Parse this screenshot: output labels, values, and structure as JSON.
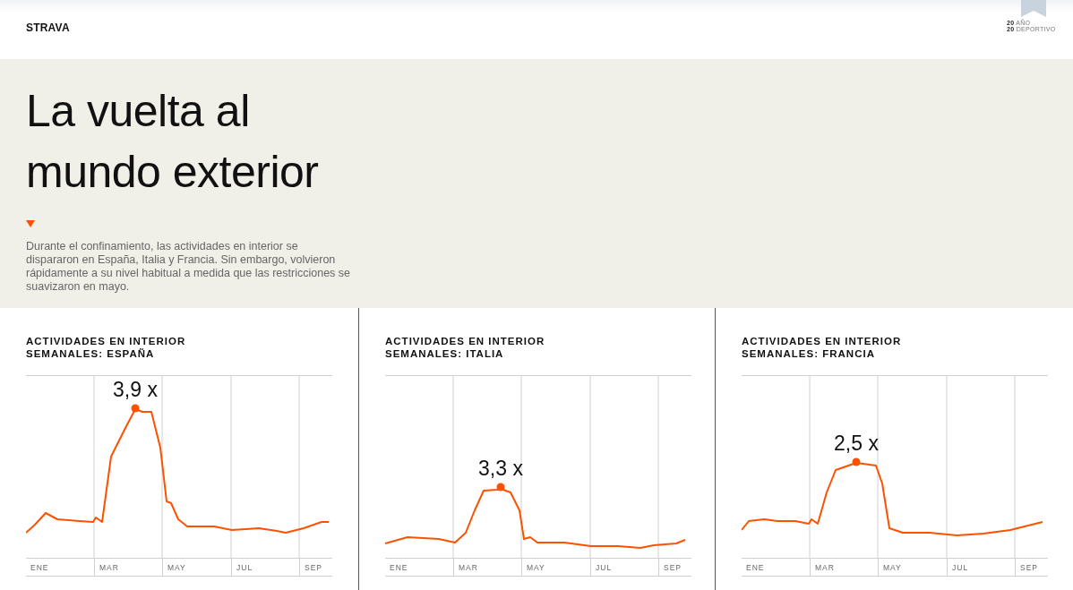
{
  "header": {
    "logo": "STRAVA",
    "badge_lines": [
      "**20** AÑO",
      "**20** DEPORTIVO"
    ]
  },
  "hero": {
    "title": "La vuelta al mundo exterior",
    "text": "Durante el confinamiento, las actividades en interior se dispararon en España, Italia y Francia. Sin embargo, volvieron rápidamente a su nivel habitual a medida que las restricciones se suavizaron en mayo."
  },
  "panels": [
    {
      "title": "ACTIVIDADES EN INTERIOR SEMANALES: ESPAÑA",
      "peak_label": "3,9 x",
      "months": [
        "ENE",
        "MAR",
        "MAY",
        "JUL",
        "SEP"
      ]
    },
    {
      "title": "ACTIVIDADES EN INTERIOR SEMANALES: ITALIA",
      "peak_label": "3,3 x",
      "months": [
        "ENE",
        "MAR",
        "MAY",
        "JUL",
        "SEP"
      ]
    },
    {
      "title": "ACTIVIDADES EN INTERIOR SEMANALES: FRANCIA",
      "peak_label": "2,5 x",
      "months": [
        "ENE",
        "MAR",
        "MAY",
        "JUL",
        "SEP"
      ]
    }
  ]
}
